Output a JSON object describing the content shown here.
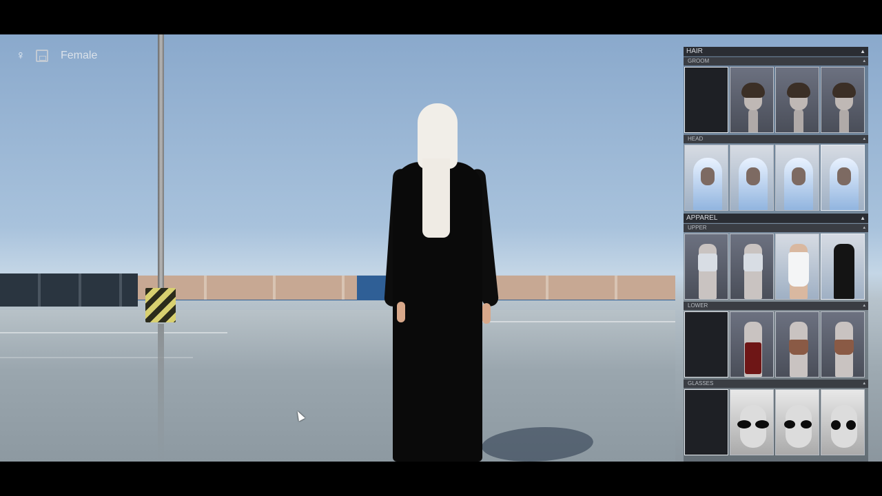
{
  "hud": {
    "gender_icon": "female-icon",
    "save_icon": "save-icon",
    "gender_label": "Female"
  },
  "panel": {
    "sections": [
      {
        "label": "HAIR",
        "collapse_icon": "▲",
        "subsections": [
          {
            "label": "GROOM",
            "collapse_icon": "▴",
            "items": [
              "none",
              "groom-1",
              "groom-2",
              "groom-3"
            ]
          },
          {
            "label": "HEAD",
            "collapse_icon": "▴",
            "items": [
              "hijab-1",
              "hijab-2",
              "hijab-3",
              "hijab-4"
            ]
          }
        ]
      },
      {
        "label": "APPAREL",
        "collapse_icon": "▲",
        "subsections": [
          {
            "label": "UPPER",
            "collapse_icon": "▴",
            "items": [
              "top-1",
              "top-2",
              "white-dress",
              "black-dress"
            ]
          },
          {
            "label": "LOWER",
            "collapse_icon": "▴",
            "items": [
              "none",
              "red-pants",
              "skirt-1",
              "skirt-2"
            ]
          },
          {
            "label": "GLASSES",
            "collapse_icon": "▴",
            "items": [
              "none",
              "sunglasses-1",
              "sunglasses-2",
              "sunglasses-3"
            ]
          }
        ]
      }
    ]
  },
  "colors": {
    "panel_header": "#2a2d33",
    "panel_subheader": "#3a3d43",
    "thumb_border": "#b9bec6"
  }
}
